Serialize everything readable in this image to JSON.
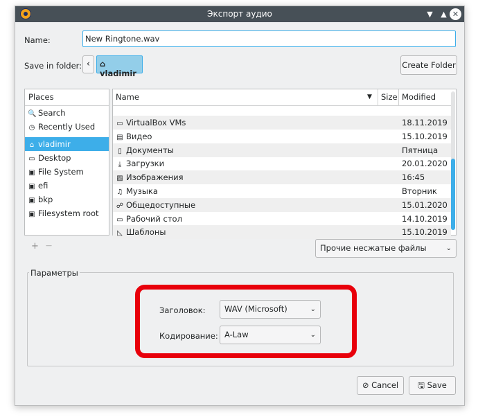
{
  "window": {
    "title": "Экспорт аудио",
    "icon": "audacity-icon",
    "controls": [
      "chevron-down-icon",
      "chevron-up-icon",
      "close-icon"
    ]
  },
  "name_row": {
    "label": "Name:",
    "value": "New Ringtone.wav"
  },
  "folder_row": {
    "label": "Save in folder:",
    "back_glyph": "‹",
    "home_glyph": "⌂",
    "crumb": "vladimir",
    "create_folder": "Create Folder"
  },
  "places": {
    "header": "Places",
    "items": [
      {
        "icon": "search-icon",
        "glyph": "🔍",
        "label": "Search"
      },
      {
        "icon": "recent-icon",
        "glyph": "◷",
        "label": "Recently Used"
      },
      {
        "icon": "home-icon",
        "glyph": "⌂",
        "label": "vladimir",
        "selected": true
      },
      {
        "icon": "desktop-icon",
        "glyph": "▭",
        "label": "Desktop"
      },
      {
        "icon": "drive-icon",
        "glyph": "▣",
        "label": "File System"
      },
      {
        "icon": "drive-icon",
        "glyph": "▣",
        "label": "efi"
      },
      {
        "icon": "drive-icon",
        "glyph": "▣",
        "label": "bkp"
      },
      {
        "icon": "drive-icon",
        "glyph": "▣",
        "label": "Filesystem root"
      }
    ],
    "add": "+",
    "remove": "—"
  },
  "files": {
    "columns": {
      "name": "Name",
      "size": "Size",
      "modified": "Modified"
    },
    "sort_glyph": "▼",
    "rows": [
      {
        "icon": "folder-icon",
        "glyph": "▭",
        "name": "VirtualBox VMs",
        "modified": "18.11.2019"
      },
      {
        "icon": "video-icon",
        "glyph": "▤",
        "name": "Видео",
        "modified": "15.10.2019"
      },
      {
        "icon": "documents-icon",
        "glyph": "▯",
        "name": "Документы",
        "modified": "Пятница"
      },
      {
        "icon": "download-icon",
        "glyph": "⤓",
        "name": "Загрузки",
        "modified": "20.01.2020"
      },
      {
        "icon": "pictures-icon",
        "glyph": "▨",
        "name": "Изображения",
        "modified": "16:45"
      },
      {
        "icon": "music-icon",
        "glyph": "♫",
        "name": "Музыка",
        "modified": "Вторник"
      },
      {
        "icon": "share-icon",
        "glyph": "☍",
        "name": "Общедоступные",
        "modified": "15.01.2020"
      },
      {
        "icon": "desktop-icon",
        "glyph": "▭",
        "name": "Рабочий стол",
        "modified": "14.10.2019"
      },
      {
        "icon": "templates-icon",
        "glyph": "◺",
        "name": "Шаблоны",
        "modified": "15.10.2019"
      }
    ]
  },
  "filter": {
    "value": "Прочие несжатые файлы"
  },
  "params": {
    "title": "Параметры",
    "header_label": "Заголовок:",
    "header_value": "WAV (Microsoft)",
    "encoding_label": "Кодирование:",
    "encoding_value": "A-Law"
  },
  "buttons": {
    "cancel": "Cancel",
    "save": "Save",
    "cancel_glyph": "⊘",
    "save_glyph": "🖫"
  },
  "colors": {
    "accent": "#3daee9",
    "titlebar": "#475057",
    "highlight": "#e8000b"
  }
}
